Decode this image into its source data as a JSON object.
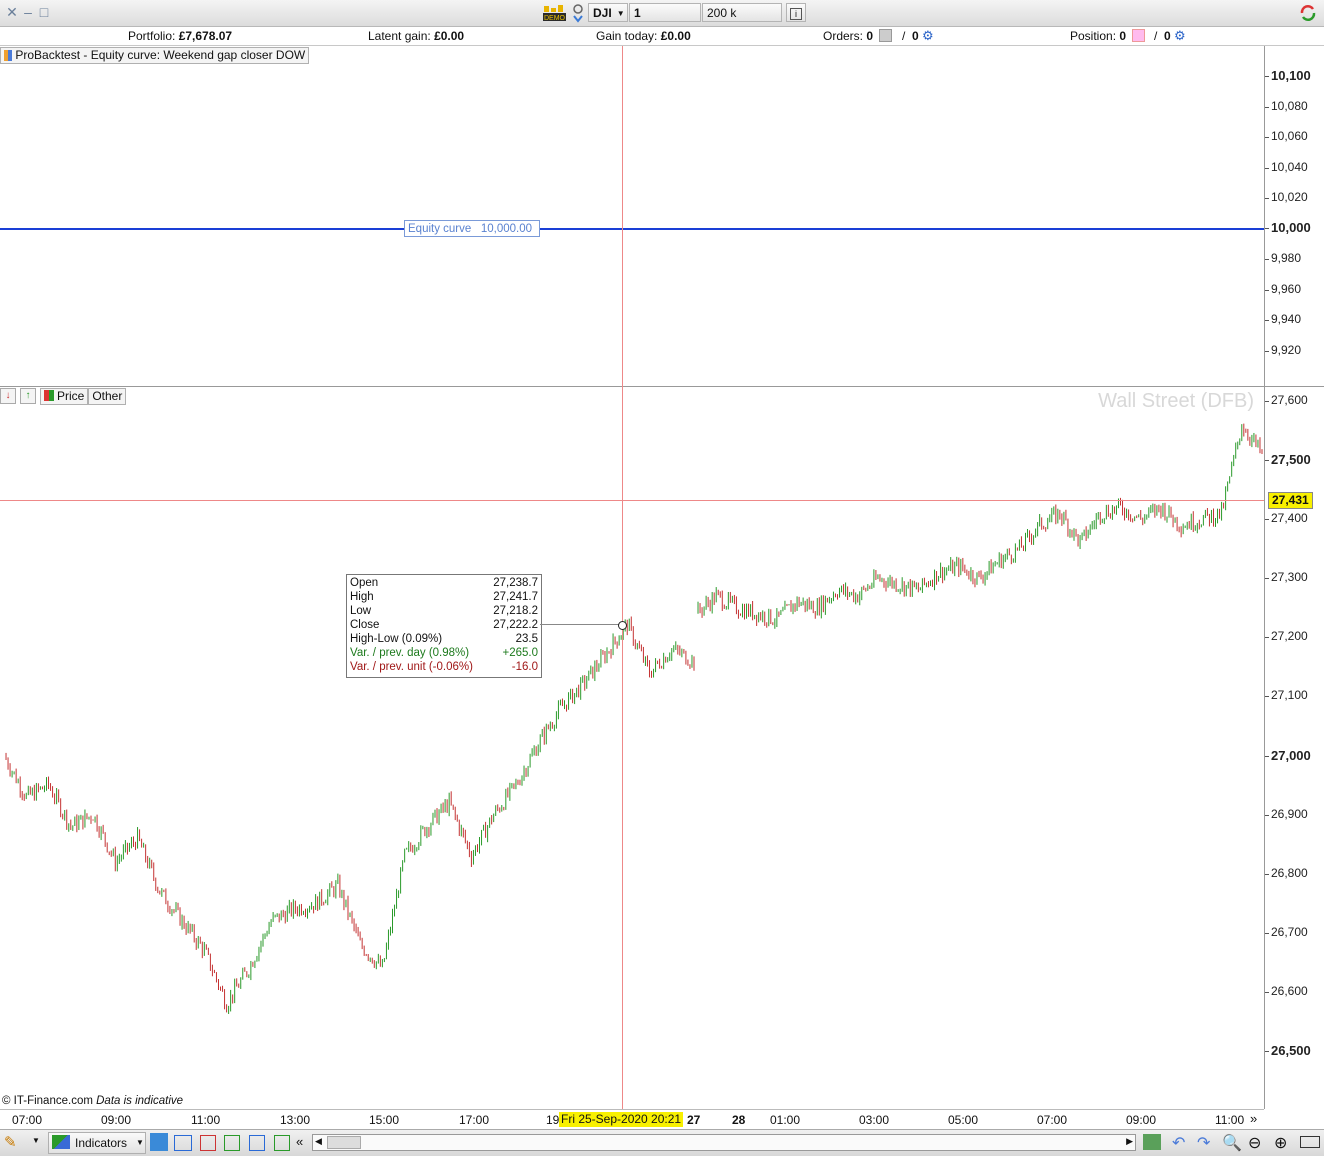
{
  "toolbar": {
    "instrument": "DJI",
    "timeframe": "1 minute",
    "units": "200 k units",
    "demo_label": "DEMO"
  },
  "info": {
    "portfolio_label": "Portfolio:",
    "portfolio_value": "£7,678.07",
    "latent_label": "Latent gain:",
    "latent_value": "£0.00",
    "gain_label": "Gain today:",
    "gain_value": "£0.00",
    "orders_label": "Orders:",
    "orders_value": "0",
    "orders_sep": "/",
    "orders_value2": "0",
    "position_label": "Position:",
    "position_value": "0",
    "position_sep": "/",
    "position_value2": "0"
  },
  "equity_pane": {
    "tag": "ProBacktest - Equity curve: Weekend gap closer DOW",
    "line_label": "Equity curve",
    "line_value": "10,000.00",
    "line_color": "#1a3fd6",
    "y_labels": [
      "10,100",
      "10,080",
      "10,060",
      "10,040",
      "10,020",
      "10,000",
      "9,980",
      "9,960",
      "9,940",
      "9,920"
    ]
  },
  "price_pane": {
    "tag_price": "Price",
    "tag_other": "Other",
    "watermark": "Wall Street (DFB)",
    "current_price": "27,431",
    "y_labels": [
      "27,600",
      "27,500",
      "27,400",
      "27,300",
      "27,200",
      "27,100",
      "27,000",
      "26,900",
      "26,800",
      "26,700",
      "26,600",
      "26,500"
    ],
    "copyright": "© IT-Finance.com",
    "indicative": "Data is indicative"
  },
  "tooltip": {
    "rows": [
      {
        "k": "Open",
        "v": "27,238.7",
        "cls": "n"
      },
      {
        "k": "High",
        "v": "27,241.7",
        "cls": "n"
      },
      {
        "k": "Low",
        "v": "27,218.2",
        "cls": "n"
      },
      {
        "k": "Close",
        "v": "27,222.2",
        "cls": "n"
      },
      {
        "k": "High-Low (0.09%)",
        "v": "23.5",
        "cls": "n"
      },
      {
        "k": "Var. / prev. day (0.98%)",
        "v": "+265.0",
        "cls": "g"
      },
      {
        "k": "Var. / prev. unit (-0.06%)",
        "v": "-16.0",
        "cls": "r"
      }
    ]
  },
  "x_axis": {
    "labels": [
      "07:00",
      "09:00",
      "11:00",
      "13:00",
      "15:00",
      "17:00",
      "19",
      "27",
      "28",
      "01:00",
      "03:00",
      "05:00",
      "07:00",
      "09:00",
      "11:00"
    ],
    "cursor_date": "Fri 25-Sep-2020 20:21"
  },
  "bottom": {
    "indicators_label": "Indicators"
  },
  "chart_data": {
    "type": "line",
    "title": "Wall Street (DFB)",
    "ylim": [
      26450,
      27620
    ],
    "series": [
      {
        "x": [
          "07:00",
          "07:30",
          "08:00",
          "08:30",
          "09:00",
          "09:30",
          "10:00",
          "10:30",
          "11:00",
          "11:30",
          "12:00",
          "12:30",
          "13:00",
          "13:30",
          "14:00",
          "14:30",
          "15:00",
          "15:15",
          "15:30",
          "16:00",
          "16:30",
          "17:00",
          "17:30",
          "18:00",
          "18:30",
          "19:00",
          "19:30",
          "20:00",
          "20:21",
          "20:30",
          "20:45",
          "21:00",
          "22:00",
          "22:30",
          "23:00",
          "23:30",
          "00:00",
          "00:30",
          "01:00",
          "01:30",
          "02:00",
          "02:30",
          "03:00",
          "03:30",
          "04:00",
          "04:30",
          "05:00",
          "05:30",
          "06:00",
          "06:30",
          "07:00",
          "07:30",
          "08:00",
          "08:30",
          "09:00",
          "09:30",
          "10:00",
          "10:30",
          "11:00",
          "11:15",
          "11:30"
        ],
        "values": [
          27000,
          26930,
          26950,
          26880,
          26900,
          26820,
          26860,
          26770,
          26720,
          26670,
          26580,
          26640,
          26720,
          26740,
          26750,
          26780,
          26680,
          26640,
          26830,
          26880,
          26920,
          26830,
          26900,
          26950,
          27020,
          27080,
          27120,
          27170,
          27222,
          27140,
          27180,
          27160,
          27240,
          27270,
          27250,
          27240,
          27230,
          27260,
          27250,
          27280,
          27270,
          27300,
          27290,
          27280,
          27310,
          27320,
          27300,
          27330,
          27350,
          27390,
          27410,
          27360,
          27410,
          27420,
          27400,
          27420,
          27390,
          27400,
          27410,
          27560,
          27510
        ]
      }
    ]
  }
}
